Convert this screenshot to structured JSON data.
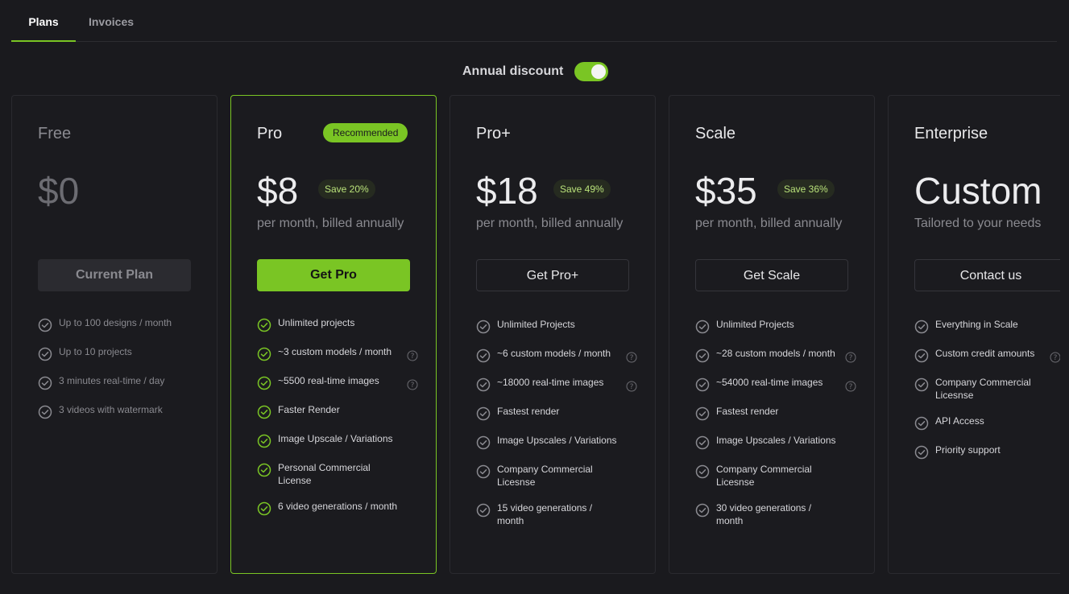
{
  "tabs": [
    {
      "label": "Plans",
      "active": true
    },
    {
      "label": "Invoices",
      "active": false
    }
  ],
  "discount": {
    "label": "Annual discount",
    "enabled": true
  },
  "colors": {
    "accent": "#7ac524",
    "background": "#1a1a1e",
    "card_border": "#2a2a2f"
  },
  "plans": [
    {
      "name": "Free",
      "price": "$0",
      "subtext": "",
      "button": "Current Plan",
      "features": [
        {
          "text": "Up to 100 designs / month",
          "help": false
        },
        {
          "text": "Up to 10 projects",
          "help": false
        },
        {
          "text": "3 minutes real-time / day",
          "help": false
        },
        {
          "text": "3 videos with watermark",
          "help": false
        }
      ]
    },
    {
      "name": "Pro",
      "badge": "Recommended",
      "price": "$8",
      "save": "Save 20%",
      "subtext": "per month, billed annually",
      "button": "Get Pro",
      "features": [
        {
          "text": "Unlimited projects",
          "help": false
        },
        {
          "text": "~3 custom models / month",
          "help": true
        },
        {
          "text": "~5500 real-time images",
          "help": true
        },
        {
          "text": "Faster Render",
          "help": false
        },
        {
          "text": "Image Upscale / Variations",
          "help": false
        },
        {
          "text": "Personal Commercial License",
          "help": false
        },
        {
          "text": "6 video generations / month",
          "help": false
        }
      ]
    },
    {
      "name": "Pro+",
      "price": "$18",
      "save": "Save 49%",
      "subtext": "per month, billed annually",
      "button": "Get Pro+",
      "features": [
        {
          "text": "Unlimited Projects",
          "help": false
        },
        {
          "text": "~6 custom models / month",
          "help": true
        },
        {
          "text": "~18000 real-time images",
          "help": true
        },
        {
          "text": "Fastest render",
          "help": false
        },
        {
          "text": "Image Upscales / Variations",
          "help": false
        },
        {
          "text": "Company Commercial Licesnse",
          "help": false
        },
        {
          "text": "15 video generations / month",
          "help": false
        }
      ]
    },
    {
      "name": "Scale",
      "price": "$35",
      "save": "Save 36%",
      "subtext": "per month, billed annually",
      "button": "Get Scale",
      "features": [
        {
          "text": "Unlimited Projects",
          "help": false
        },
        {
          "text": "~28 custom models / month",
          "help": true
        },
        {
          "text": "~54000 real-time images",
          "help": true
        },
        {
          "text": "Fastest render",
          "help": false
        },
        {
          "text": "Image Upscales / Variations",
          "help": false
        },
        {
          "text": "Company Commercial Licesnse",
          "help": false
        },
        {
          "text": "30 video generations / month",
          "help": false
        }
      ]
    },
    {
      "name": "Enterprise",
      "price": "Custom",
      "subtext": "Tailored to your needs",
      "button": "Contact us",
      "features": [
        {
          "text": "Everything in Scale",
          "help": false
        },
        {
          "text": "Custom credit amounts",
          "help": true
        },
        {
          "text": "Company Commercial Licesnse",
          "help": false
        },
        {
          "text": "API Access",
          "help": false
        },
        {
          "text": "Priority support",
          "help": false
        }
      ]
    }
  ]
}
